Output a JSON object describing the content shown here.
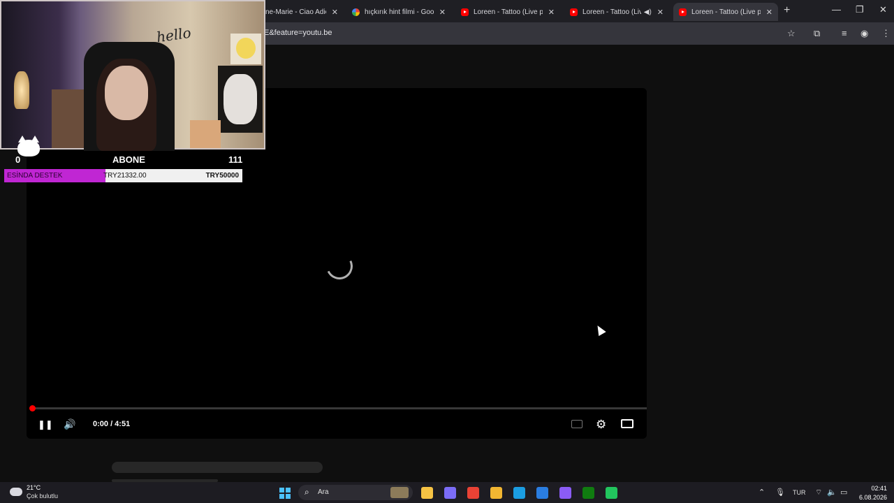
{
  "browser": {
    "tabs": [
      {
        "title": "ne-Marie - Ciao Adios",
        "icon": "partial-tab",
        "active": false
      },
      {
        "title": "hıçkırık hint filmi - Google",
        "icon": "google-icon",
        "active": false
      },
      {
        "title": "Loreen - Tattoo (Live pe",
        "icon": "youtube-icon",
        "active": false
      },
      {
        "title": "Loreen - Tattoo (Live",
        "icon": "youtube-icon",
        "active": false,
        "audio": true
      },
      {
        "title": "Loreen - Tattoo (Live pe",
        "icon": "youtube-icon",
        "active": true
      }
    ],
    "close_glyph": "✕",
    "new_tab_glyph": "+",
    "url": "E&feature=youtu.be",
    "window_buttons": {
      "minimize": "—",
      "restore": "❐",
      "close": "✕"
    },
    "toolbar_icons": {
      "bookmark": "☆",
      "extensions": "⧉",
      "media": "≡",
      "profile": "◉",
      "menu": "⋮"
    }
  },
  "player": {
    "time": "0:00 / 4:51",
    "progress": 0.0,
    "state": "loading",
    "pause_glyph": "❚❚",
    "volume_glyph": "🔊",
    "settings_glyph": "⚙"
  },
  "overlay": {
    "cam_text": "hello",
    "sub_goal": {
      "start": "0",
      "label": "ABONE",
      "end": "111"
    },
    "donation": {
      "label": "ESİNDA DESTEK",
      "current": "TRY21332.00",
      "goal": "TRY50000",
      "fraction": 0.4264,
      "color": "#c026d3"
    }
  },
  "taskbar": {
    "weather": {
      "temp": "21°C",
      "condition": "Çok bulutlu"
    },
    "search_placeholder": "Ara",
    "language": "TUR",
    "time": "02:41",
    "date": "6.08.2026",
    "apps": [
      {
        "name": "file-explorer",
        "color": "#f6c344"
      },
      {
        "name": "copilot",
        "color": "#7b6cf6"
      },
      {
        "name": "chrome",
        "color": "#e94235"
      },
      {
        "name": "folder",
        "color": "#f2b632"
      },
      {
        "name": "edge",
        "color": "#1b9de2"
      },
      {
        "name": "store",
        "color": "#2a7de1"
      },
      {
        "name": "app-purple",
        "color": "#8b5cf6"
      },
      {
        "name": "xbox",
        "color": "#107c10"
      },
      {
        "name": "app-green",
        "color": "#22c55e"
      }
    ]
  }
}
